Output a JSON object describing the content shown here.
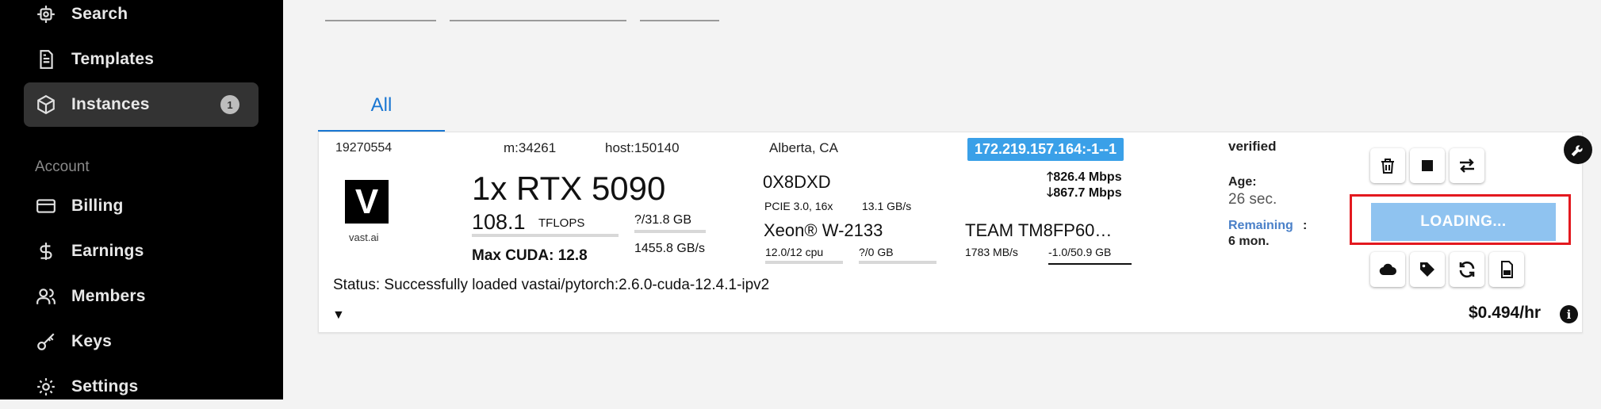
{
  "sidebar": {
    "items": [
      {
        "label": "Search",
        "icon": "search-icon"
      },
      {
        "label": "Templates",
        "icon": "templates-icon"
      },
      {
        "label": "Instances",
        "icon": "cube-icon",
        "badge": "1"
      },
      {
        "label": "Billing",
        "icon": "credit-card-icon"
      },
      {
        "label": "Earnings",
        "icon": "dollar-icon"
      },
      {
        "label": "Members",
        "icon": "users-icon"
      },
      {
        "label": "Keys",
        "icon": "key-icon"
      },
      {
        "label": "Settings",
        "icon": "gear-icon"
      }
    ],
    "section_account": "Account"
  },
  "tabs": [
    {
      "label": "All"
    }
  ],
  "instance": {
    "id": "19270554",
    "machine": "m:34261",
    "host": "host:150140",
    "location": "Alberta, CA",
    "ip": "172.219.157.164:-1--1",
    "logo_letter": "V",
    "logo_text": "vast.ai",
    "gpu": "1x RTX 5090",
    "tflops_value": "108.1",
    "tflops_unit": "TFLOPS",
    "vram": "?/31.8 GB",
    "mem_bandwidth": "1455.8 GB/s",
    "max_cuda": "Max CUDA: 12.8",
    "motherboard": "0X8DXD",
    "pcie": "PCIE 3.0, 16x",
    "pcie_bw": "13.1 GB/s",
    "cpu": "Xeon® W-2133",
    "cpu_cores": "12.0/12 cpu",
    "ram": "?/0 GB",
    "upload": "826.4 Mbps",
    "download": "867.7 Mbps",
    "disk": "TEAM TM8FP60…",
    "disk_speed": "1783 MB/s",
    "disk_usage": "-1.0/50.9 GB",
    "verified": "verified",
    "age_label": "Age:",
    "age_value": "26 sec.",
    "remaining_label": "Remaining",
    "remaining_colon": ":",
    "remaining_value": "6 mon.",
    "loading_label": "LOADING...",
    "status": "Status: Successfully loaded vastai/pytorch:2.6.0-cuda-12.4.1-ipv2",
    "price": "$0.494/hr"
  },
  "colors": {
    "accent": "#1976d2",
    "ip_badge": "#3aa0e8",
    "loading_button": "#8fc3f0",
    "highlight_border": "#e3191f",
    "remaining_label": "#4a80c8"
  }
}
